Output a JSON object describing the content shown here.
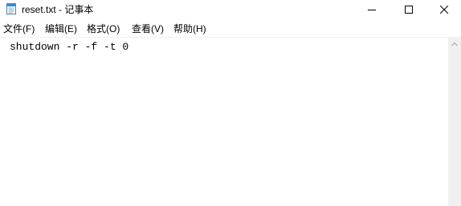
{
  "window": {
    "title": "reset.txt - 记事本"
  },
  "icons": {
    "app": "notepad-icon",
    "minimize": "minimize-icon",
    "maximize": "maximize-icon",
    "close": "close-icon",
    "scroll_up": "chevron-up-icon"
  },
  "menu": {
    "file": "文件(F)",
    "edit": "编辑(E)",
    "format": "格式(O)",
    "view": "查看(V)",
    "help": "帮助(H)"
  },
  "editor": {
    "content": "shutdown -r -f -t 0"
  },
  "colors": {
    "background": "#ffffff",
    "scrollbar_track": "#f0f0f0",
    "icon_accent": "#2f8fd8"
  }
}
